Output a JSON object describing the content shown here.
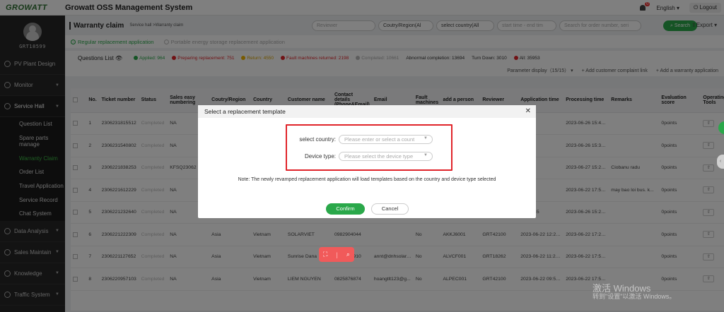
{
  "header": {
    "logo": "GROWATT",
    "title": "Growatt OSS Management System",
    "notifications": "0",
    "language": "English",
    "logout": "Logout"
  },
  "user": {
    "name": "GRT18599"
  },
  "sidebar": {
    "items": [
      {
        "label": "PV Plant Design",
        "icon": "plant-icon"
      },
      {
        "label": "Monitor",
        "icon": "monitor-icon"
      },
      {
        "label": "Service Hall",
        "icon": "service-icon"
      },
      {
        "label": "Data Analysis",
        "icon": "analysis-icon"
      },
      {
        "label": "Sales Maintain",
        "icon": "sales-icon"
      },
      {
        "label": "Knowledge",
        "icon": "knowledge-icon"
      },
      {
        "label": "Traffic System",
        "icon": "traffic-icon"
      }
    ],
    "subitems": [
      "Question List",
      "Spare parts manage",
      "Warranty Claim",
      "Order List",
      "Travel Application",
      "Service Record",
      "Chat System"
    ]
  },
  "page": {
    "title": "Warranty claim",
    "breadcrumb": "Service hall >Warranty claim"
  },
  "filters": {
    "reviewer": "Reviewer",
    "region": "Coutry/Region(Al",
    "country": "select country(All",
    "time": "start time - end tim",
    "search_placeholder": "Search for order number, seri",
    "search_btn": "Search",
    "export": "Export"
  },
  "tabs": [
    "Regular replacement application",
    "Portable energy storage replacement application"
  ],
  "questions": {
    "title": "Questions List",
    "stats": [
      {
        "label": "Applied: 964",
        "color": "#2aa84a"
      },
      {
        "label": "Preparing replacement: 751",
        "color": "#e0242a"
      },
      {
        "label": "Return: 4550",
        "color": "#f0b400"
      },
      {
        "label": "Fault machines returned: 2198",
        "color": "#e0242a"
      },
      {
        "label": "Completed: 10661",
        "color": "#bbbbbb"
      }
    ],
    "abnormal": "Abnormal completion: 13694",
    "turndown": "Turn Down: 3010",
    "all": "All: 35953"
  },
  "param_bar": {
    "display": "Parameter display（15/15）",
    "add_complaint": "Add customer complaint link",
    "add_warranty": "Add a warranty application"
  },
  "table": {
    "headers": [
      "No.",
      "Ticket number",
      "Status",
      "Sales easy numbering",
      "Coutry/Region",
      "Country",
      "Customer name",
      "Contact details (Phone&Email)",
      "Email",
      "Fault machines",
      "add a person",
      "Reviewer",
      "Application time",
      "Processing time",
      "Remarks",
      "Evaluation score",
      "Operating Tools"
    ],
    "rows": [
      [
        "1",
        "2306231815512",
        "Completed",
        "NA",
        "",
        "",
        "",
        "",
        "",
        "",
        "",
        "",
        "23",
        "2023-06-26 15:48:08",
        "",
        "0points"
      ],
      [
        "2",
        "2306231540802",
        "Completed",
        "NA",
        "",
        "",
        "",
        "",
        "",
        "",
        "",
        "",
        "23",
        "2023-06-26 15:34:56",
        "",
        "0points"
      ],
      [
        "3",
        "2306221838253",
        "Completed",
        "KFSQ23062",
        "",
        "",
        "",
        "",
        "",
        "",
        "",
        "",
        "22",
        "2023-06-27 15:24:14",
        "Ciobanu radu",
        "0points"
      ],
      [
        "4",
        "2306221612229",
        "Completed",
        "NA",
        "",
        "",
        "",
        "",
        "",
        "",
        "",
        "",
        "22",
        "2023-06-22 17:56:53",
        "may bao loi bus. k...",
        "0points"
      ],
      [
        "5",
        "2306221232640",
        "Completed",
        "NA",
        "",
        "",
        "",
        "",
        "",
        "",
        "",
        "",
        "12:32:45",
        "2023-06-26 15:28:27",
        "",
        "0points"
      ],
      [
        "6",
        "2306221222309",
        "Completed",
        "NA",
        "Asia",
        "Vietnam",
        "SOLARVIET",
        "0982904044",
        "",
        "No",
        "AKKJ6001",
        "GRT42100",
        "2023-06-22 12:22:18",
        "2023-06-22 17:29:26",
        "",
        "0points"
      ],
      [
        "7",
        "2306221127652",
        "Completed",
        "NA",
        "Asia",
        "Vietnam",
        "Sunrise Dana",
        "0905050910",
        "annt@dnhsolar....",
        "No",
        "ALVCF001",
        "GRT18262",
        "2023-06-22 11:27:16",
        "2023-06-22 17:54:45",
        "",
        "0points"
      ],
      [
        "8",
        "2306220957103",
        "Completed",
        "NA",
        "Asia",
        "Vietnam",
        "LIEM NGUYEN",
        "0825876874",
        "hoangtlt123@g...",
        "No",
        "ALPEC001",
        "GRT42100",
        "2023-06-22 09:57:33",
        "2023-06-22 17:50:34",
        "",
        "0points"
      ]
    ]
  },
  "modal": {
    "title": "Select a replacement template",
    "country_label": "select country:",
    "country_placeholder": "Please enter or select a count",
    "device_label": "Device type:",
    "device_placeholder": "Please select the device type",
    "note": "Note: The newly revamped replacement application will load templates based on the country and device type selected",
    "confirm": "Confirm",
    "cancel": "Cancel"
  },
  "watermark": {
    "line1": "激活 Windows",
    "line2": "转到\"设置\"以激活 Windows。"
  }
}
